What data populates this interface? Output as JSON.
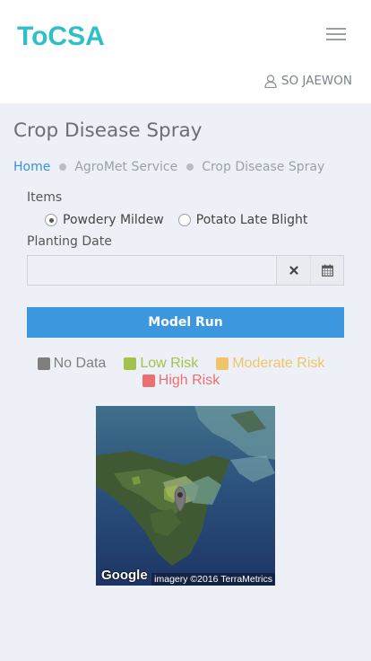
{
  "header": {
    "logo": "ToCSA",
    "user_name": "SO JAEWON"
  },
  "page": {
    "title": "Crop Disease Spray",
    "breadcrumb": [
      "Home",
      "AgroMet Service",
      "Crop Disease Spray"
    ]
  },
  "form": {
    "items_label": "Items",
    "options": [
      {
        "label": "Powdery Mildew",
        "checked": true
      },
      {
        "label": "Potato Late Blight",
        "checked": false
      }
    ],
    "planting_date_label": "Planting Date",
    "planting_date_value": "",
    "run_label": "Model Run"
  },
  "legend": [
    {
      "label": "No Data",
      "color": "#7f7f7f"
    },
    {
      "label": "Low Risk",
      "color": "#a3c24a"
    },
    {
      "label": "Moderate Risk",
      "color": "#f0c56a"
    },
    {
      "label": "High Risk",
      "color": "#ee6f6f"
    }
  ],
  "map": {
    "brand": "Google",
    "credit": "imagery ©2016 TerraMetrics"
  },
  "icons": {
    "menu": "hamburger-icon",
    "user": "user-icon",
    "clear": "close-icon",
    "calendar": "calendar-icon",
    "marker": "map-marker-icon"
  },
  "colors": {
    "brand": "#2fbfc7",
    "primary_button": "#3d97df",
    "link": "#3a8fd6"
  }
}
